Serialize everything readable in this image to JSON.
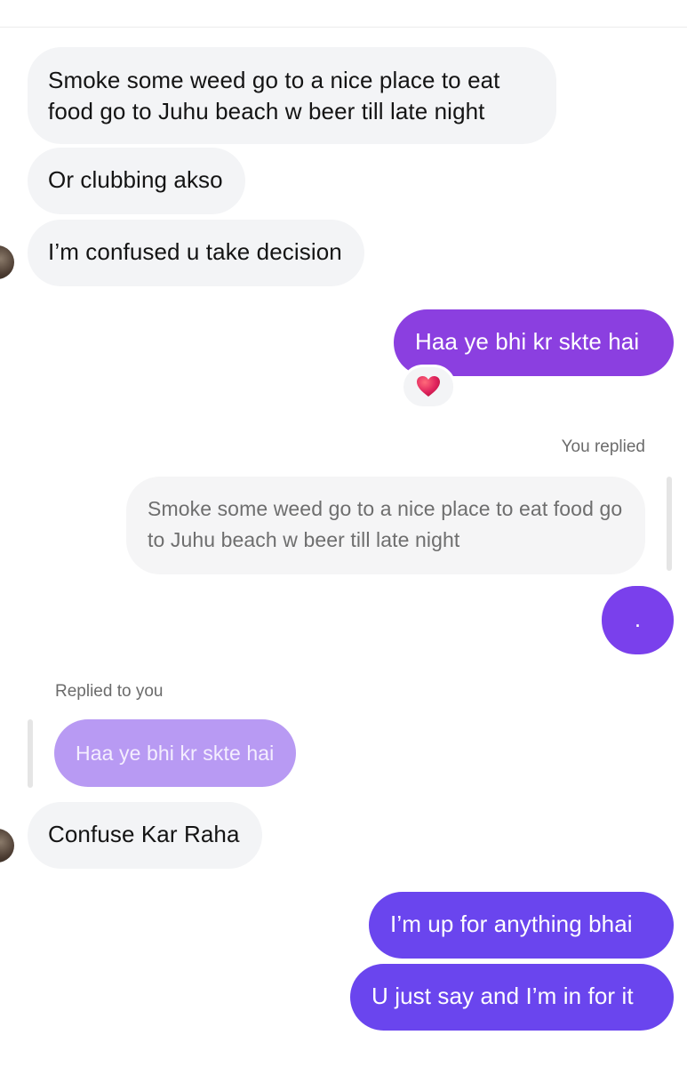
{
  "conversation": {
    "messages": [
      {
        "text": "Smoke some weed go to a nice place to eat food go to Juhu beach w beer till late night"
      },
      {
        "text": "Or clubbing akso"
      },
      {
        "text": "I’m confused u take decision"
      },
      {
        "text": "Haa ye bhi kr skte hai",
        "reaction": "heart"
      },
      {
        "reply_label": "You replied",
        "quoted_text": "Smoke some weed go to a nice place to eat food go to Juhu beach w beer till late night",
        "text": "."
      },
      {
        "reply_label": "Replied to you",
        "quoted_text": "Haa ye bhi kr skte hai",
        "text": "Confuse Kar Raha"
      },
      {
        "text": "I’m up for anything bhai"
      },
      {
        "text": "U just say and I’m in for it"
      }
    ]
  },
  "colors": {
    "incoming_bubble": "#f3f4f6",
    "outgoing_purple_1": "#8b3fe0",
    "outgoing_purple_2": "#7a40ec",
    "outgoing_purple_3": "#6a45ee",
    "quoted_purple": "#b89af3",
    "reaction_heart": "#e0245e"
  },
  "icons": {
    "reaction": "heart-icon",
    "avatar": "avatar"
  }
}
